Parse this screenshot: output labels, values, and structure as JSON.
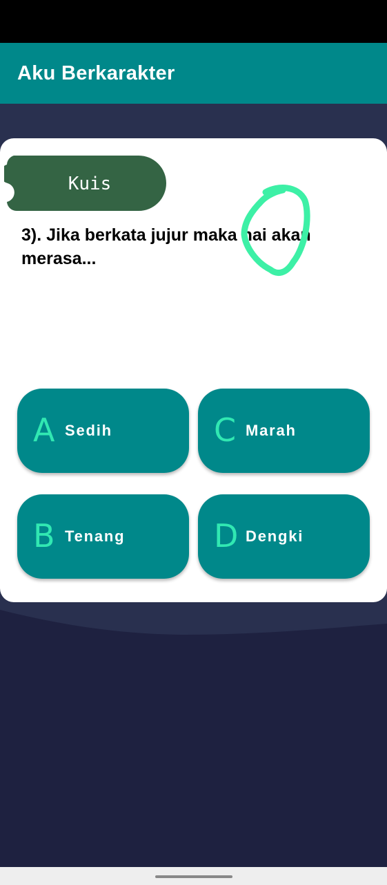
{
  "app_bar": {
    "title": "Aku Berkarakter"
  },
  "quiz": {
    "tab_label": "Kuis",
    "question": "3). Jika berkata jujur maka hai akan merasa...",
    "answers": [
      {
        "letter": "A",
        "text": "Sedih"
      },
      {
        "letter": "C",
        "text": "Marah"
      },
      {
        "letter": "B",
        "text": "Tenang"
      },
      {
        "letter": "D",
        "text": "Dengki"
      }
    ]
  },
  "colors": {
    "status_bar": "#000000",
    "app_bar": "#00888a",
    "background_dark": "#1e2140",
    "background_wave": "#29304f",
    "card": "#ffffff",
    "tab": "#346444",
    "answer_button": "#00888a",
    "answer_letter": "#31e8b2",
    "scribble": "#3df0a6"
  }
}
